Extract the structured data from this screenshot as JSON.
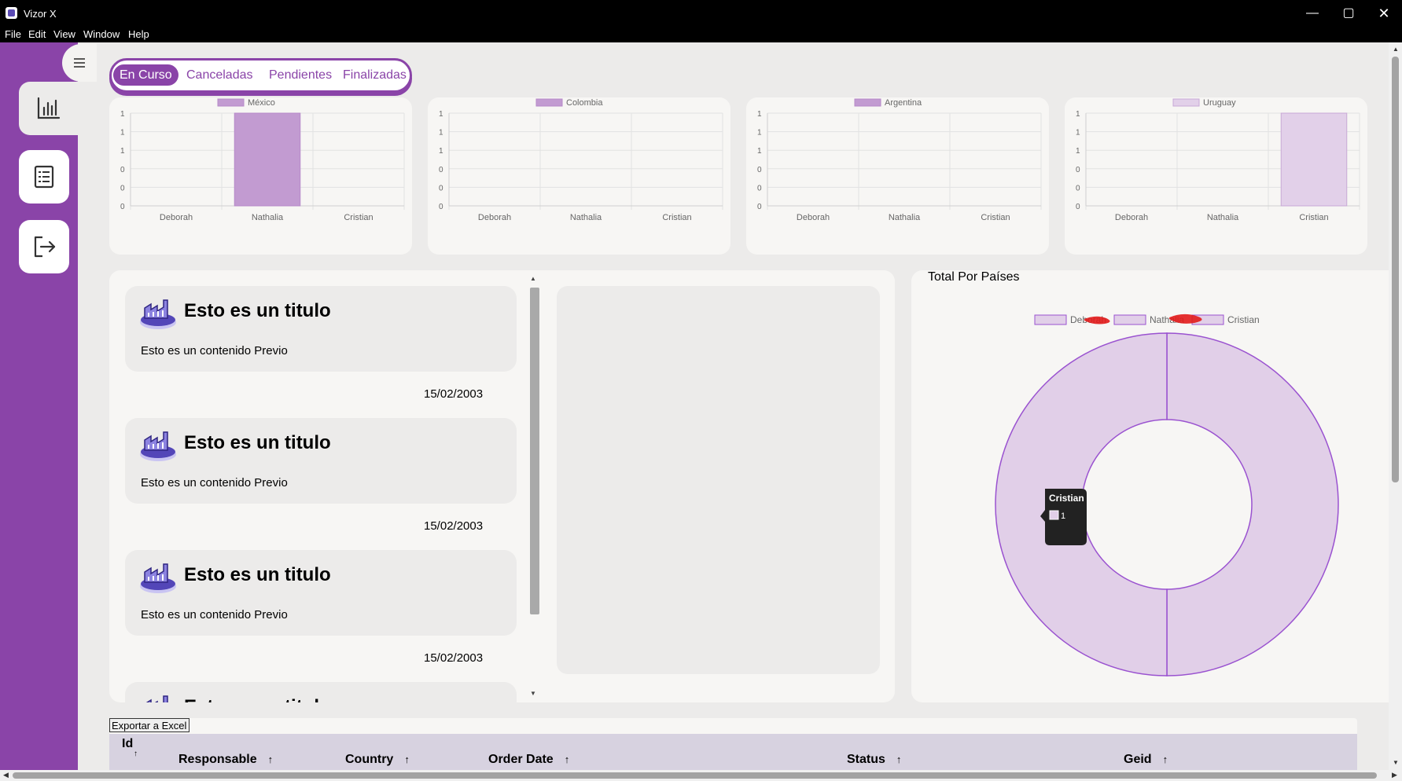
{
  "window": {
    "title": "Vizor X",
    "minimize": "—",
    "maximize": "▢",
    "close": "✕"
  },
  "menu": [
    "File",
    "Edit",
    "View",
    "Window",
    "Help"
  ],
  "sidebar": {
    "items": [
      {
        "icon": "bar-chart-icon",
        "active": true
      },
      {
        "icon": "list-document-icon",
        "active": false
      },
      {
        "icon": "logout-icon",
        "active": false
      }
    ],
    "toggle_icon": "hamburger-icon"
  },
  "tabs": [
    {
      "label": "En Curso",
      "active": true
    },
    {
      "label": "Canceladas",
      "active": false
    },
    {
      "label": "Pendientes",
      "active": false
    },
    {
      "label": "Finalizadas",
      "active": false
    }
  ],
  "chart_data": [
    {
      "type": "bar",
      "legend": "México",
      "categories": [
        "Deborah",
        "Nathalia",
        "Cristian"
      ],
      "values": [
        0,
        1,
        0
      ],
      "yticks": [
        "1",
        "1",
        "1",
        "0",
        "0",
        "0"
      ],
      "color": "#c29bd1",
      "border": "#b78ac9"
    },
    {
      "type": "bar",
      "legend": "Colombia",
      "categories": [
        "Deborah",
        "Nathalia",
        "Cristian"
      ],
      "values": [
        0,
        0,
        0
      ],
      "yticks": [
        "1",
        "1",
        "1",
        "0",
        "0",
        "0"
      ],
      "color": "#c29bd1",
      "border": "#b78ac9"
    },
    {
      "type": "bar",
      "legend": "Argentina",
      "categories": [
        "Deborah",
        "Nathalia",
        "Cristian"
      ],
      "values": [
        0,
        0,
        0
      ],
      "yticks": [
        "1",
        "1",
        "1",
        "0",
        "0",
        "0"
      ],
      "color": "#c29bd1",
      "border": "#b78ac9"
    },
    {
      "type": "bar",
      "legend": "Uruguay",
      "categories": [
        "Deborah",
        "Nathalia",
        "Cristian"
      ],
      "values": [
        0,
        0,
        1
      ],
      "yticks": [
        "1",
        "1",
        "1",
        "0",
        "0",
        "0"
      ],
      "color": "#e2d0e9",
      "border": "#c8a9d6"
    },
    {
      "type": "pie",
      "title": "Total Por Países",
      "legend": [
        "Deborah",
        "Nathalia",
        "Cristian"
      ],
      "values": [
        1,
        1
      ],
      "slice_fill": "#e1cfe8",
      "slice_stroke": "#9a52d0",
      "tooltip": {
        "label": "Cristian",
        "value": "1"
      }
    }
  ],
  "feed": {
    "items": [
      {
        "title": "Esto es un titulo",
        "content": "Esto es un contenido Previo",
        "date": "15/02/2003"
      },
      {
        "title": "Esto es un titulo",
        "content": "Esto es un contenido Previo",
        "date": "15/02/2003"
      },
      {
        "title": "Esto es un titulo",
        "content": "Esto es un contenido Previo",
        "date": "15/02/2003"
      },
      {
        "title": "Esto es un titulo",
        "content": "",
        "date": ""
      }
    ]
  },
  "export_label": "Exportar a Excel",
  "table": {
    "columns": [
      {
        "label": "Id",
        "sort": "↑"
      },
      {
        "label": "Responsable",
        "sort": "↑"
      },
      {
        "label": "Country",
        "sort": "↑"
      },
      {
        "label": "Order Date",
        "sort": "↑"
      },
      {
        "label": "Status",
        "sort": "↑"
      },
      {
        "label": "Geid",
        "sort": "↑"
      }
    ]
  },
  "colors": {
    "accent": "#8a44a8",
    "card": "#f7f6f4",
    "background": "#ecebea"
  }
}
